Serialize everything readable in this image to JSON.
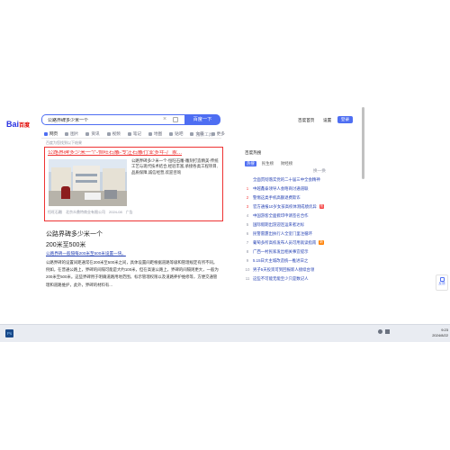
{
  "brand": {
    "logo_text": "Bai",
    "logo_text2": "百度"
  },
  "search": {
    "query": "公路界碑多少米一个",
    "button": "百度一下"
  },
  "header_links": [
    "百度首页",
    "设置"
  ],
  "login_button": "登录",
  "tabs": [
    "网页",
    "图片",
    "资讯",
    "视频",
    "笔记",
    "地图",
    "贴吧",
    "文库",
    "更多"
  ],
  "tools_label": "搜索工具",
  "result_count": "百度为您找到以下结果",
  "ad_result": {
    "title": "公路界碑多少米一个-恒旺石雕-专注石雕行业多年-厂家...",
    "desc": "公路界碑多少米一个-恒旺石雕-雕刻打造精美-传统工艺与现代技术结合,经验丰富,承接各类工程项目,品质保障,诚信经营,欢迎咨询",
    "source": "恒旺石雕",
    "date": "2024-08",
    "ad_label": "广告",
    "footer_extra": "北京众鼎特商业有限公司"
  },
  "result2": {
    "title": "公路界碑多少米一个",
    "subtitle": "200米至500米",
    "subtitle_link": "公路界碑一般隔每200米至500米设置一块。",
    "body": "公路界碑的设置间距通常在200米至500米之间，具体设置间距根据道路等级和管理规定有所不同。例如，在普通公路上，界碑的间隔可能是大约100米，但在高速公路上，界碑的间隔则更大，一般为200米至500米。这些界碑用于明确道路用地范围，标示管理权限以及道路养护维修等，方便交通管理和道路维护，此外，界碑的材料有..."
  },
  "right_panel": {
    "header": "百度热搜",
    "refresh": "换一换",
    "tabs": [
      "热搜",
      "民生榜",
      "财经榜"
    ],
    "items": [
      {
        "rank": "",
        "text": "全面贯彻落实党的二十届三中全会精神",
        "tag": ""
      },
      {
        "rank": "1",
        "text": "中越鑫泰领导人会晤商讨通道联",
        "tag": ""
      },
      {
        "rank": "2",
        "text": "警惕这类手机高额退费欺诈",
        "tag": ""
      },
      {
        "rank": "3",
        "text": "官方通报10岁女孩高校体测成绩优异",
        "tag": "热"
      },
      {
        "rank": "4",
        "text": "中国游客全面掀印申请签名合作",
        "tag": ""
      },
      {
        "rank": "5",
        "text": "国际假期出游迎连运来者达标",
        "tag": ""
      },
      {
        "rank": "6",
        "text": "民警雷霆出执行人全室门里注循环",
        "tag": ""
      },
      {
        "rank": "7",
        "text": "葡萄多所高校发布人员可用就读指南",
        "tag": "新"
      },
      {
        "rank": "8",
        "text": "广西一村民家发出相关事宜提示",
        "tag": ""
      },
      {
        "rank": "9",
        "text": "5.15日大主城改造统一推进日之",
        "tag": ""
      },
      {
        "rank": "10",
        "text": "男子5天投资可到回报新人接续台领",
        "tag": ""
      },
      {
        "rank": "11",
        "text": "这些不可能无能至少只是数记人",
        "tag": ""
      }
    ]
  },
  "taskbar": {
    "time": "9:23",
    "date": "2024/8/22",
    "float_label": "反馈"
  }
}
